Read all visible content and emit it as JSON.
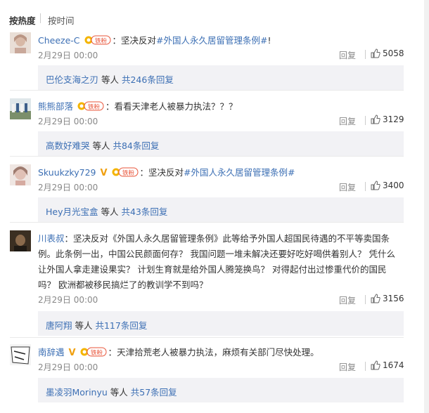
{
  "sort": {
    "hot": "按热度",
    "time": "按时间"
  },
  "labels": {
    "reply": "回复",
    "fan_badge": "铁粉",
    "v_badge": "V"
  },
  "comments": [
    {
      "author": "Cheeze-C",
      "colon": "：",
      "text_before": "坚决反对",
      "hashtag": "#外国人永久居留管理条例#",
      "text_after": "!",
      "date": "2月29日 00:00",
      "likes": "5058",
      "reply_user": "巴伦支海之刃",
      "reply_mid": " 等人 ",
      "reply_total": "共246条回复"
    },
    {
      "author": "熊熊部落",
      "colon": "：",
      "text_before": "看看天津老人被暴力执法？？？",
      "hashtag": "",
      "text_after": "",
      "date": "2月29日 00:00",
      "likes": "3129",
      "reply_user": "高数好难哭",
      "reply_mid": " 等人 ",
      "reply_total": "共84条回复"
    },
    {
      "author": "Skuukzky729",
      "colon": "：",
      "text_before": "坚决反对",
      "hashtag": "#外国人永久居留管理条例#",
      "text_after": "",
      "date": "2月29日 00:00",
      "likes": "3400",
      "reply_user": "Hey月光宝盒",
      "reply_mid": " 等人 ",
      "reply_total": "共43条回复"
    },
    {
      "author": "川表叔",
      "colon": "：",
      "text_before": "坚决反对《外国人永久居留管理条例》此等给予外国人超国民待遇的不平等卖国条例。此条例一出，中国公民颜面何存？ 我国问题一堆未解决还要好吃好喝供着别人？ 凭什么让外国人拿走建设果实？ 计划生育就是给外国人腾笼换鸟？ 对得起付出过惨重代价的国民吗？ 欧洲都被移民搞烂了的教训学不到吗？",
      "hashtag": "",
      "text_after": "",
      "date": "2月29日 00:00",
      "likes": "3156",
      "reply_user": "唐阿翔",
      "reply_mid": " 等人 ",
      "reply_total": "共117条回复"
    },
    {
      "author": "南辞遇",
      "colon": "：",
      "text_before": "天津拾荒老人被暴力执法，麻烦有关部门尽快处理。",
      "hashtag": "",
      "text_after": "",
      "date": "2月29日 00:00",
      "likes": "1674",
      "reply_user": "墨凌羽Morinyu",
      "reply_mid": " 等人 ",
      "reply_total": "共57条回复"
    }
  ],
  "colors": {
    "link": "#3c6fb4",
    "vip": "#f0a010",
    "fan_badge": "#e8553a",
    "reply_bg": "#f2f2f5"
  }
}
